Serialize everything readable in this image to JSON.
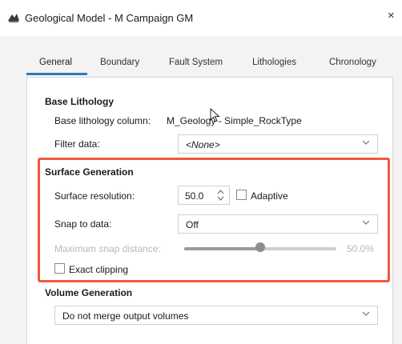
{
  "window": {
    "title": "Geological Model - M Campaign GM",
    "close_glyph": "×",
    "app_icon": "geological-model-icon"
  },
  "tabs": [
    {
      "label": "General",
      "active": true
    },
    {
      "label": "Boundary",
      "active": false
    },
    {
      "label": "Fault System",
      "active": false
    },
    {
      "label": "Lithologies",
      "active": false
    },
    {
      "label": "Chronology",
      "active": false
    }
  ],
  "base_lithology": {
    "title": "Base Lithology",
    "column_label": "Base lithology column:",
    "column_value": "M_Geology - Simple_RockType",
    "filter_label": "Filter data:",
    "filter_value": "<None>"
  },
  "surface_generation": {
    "title": "Surface Generation",
    "resolution_label": "Surface resolution:",
    "resolution_value": "50.0",
    "adaptive_label": "Adaptive",
    "adaptive_checked": false,
    "snap_label": "Snap to data:",
    "snap_value": "Off",
    "max_snap_label": "Maximum snap distance:",
    "max_snap_value": "50.0%",
    "max_snap_fraction": 0.5,
    "exact_clipping_label": "Exact clipping",
    "exact_clipping_checked": false
  },
  "volume_generation": {
    "title": "Volume Generation",
    "value": "Do not merge output volumes"
  },
  "colors": {
    "accent": "#2b78c2",
    "highlight": "#ef5a3b"
  }
}
